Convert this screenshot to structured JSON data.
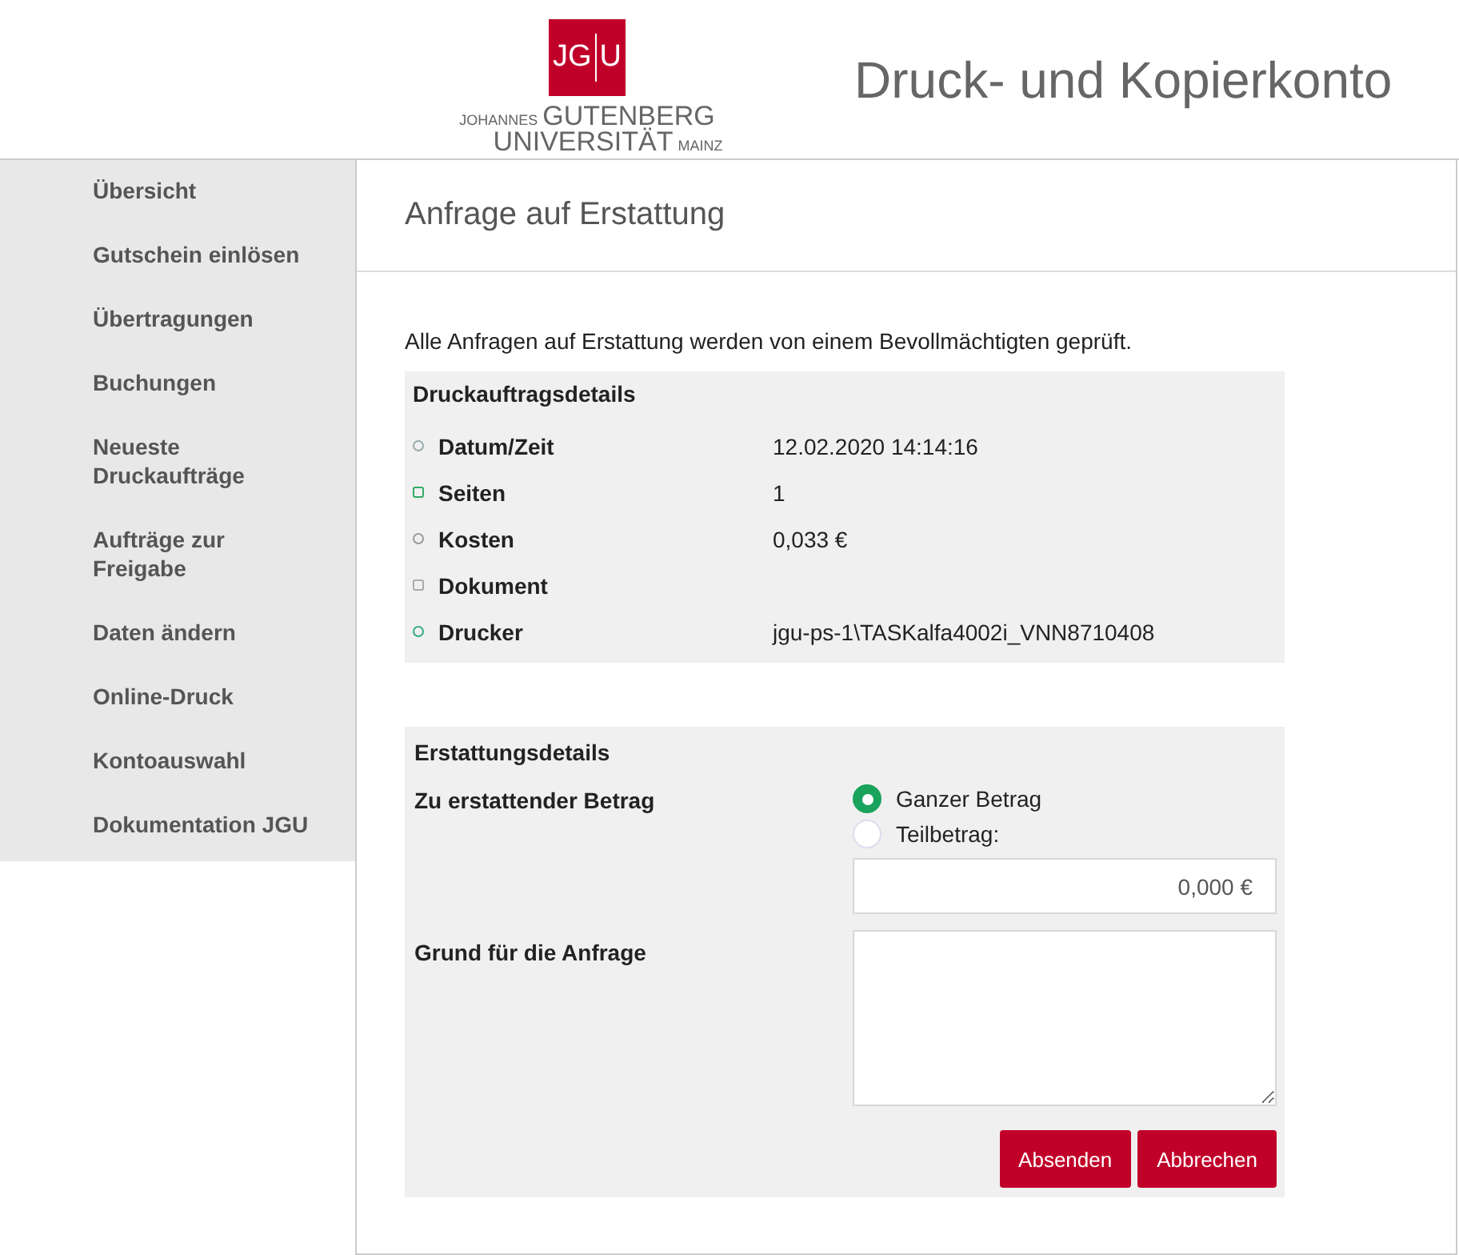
{
  "logo": {
    "mark_left": "JG",
    "mark_right": "U",
    "line1_small": "JOHANNES",
    "line1_big": "GUTENBERG",
    "line2_big": "UNIVERSITÄT",
    "line2_small": "MAINZ"
  },
  "header": {
    "title": "Druck- und Kopierkonto"
  },
  "sidebar": {
    "items": [
      {
        "label": "Übersicht"
      },
      {
        "label": "Gutschein einlösen"
      },
      {
        "label": "Übertragungen"
      },
      {
        "label": "Buchungen"
      },
      {
        "label": "Neueste Druckaufträge"
      },
      {
        "label": "Aufträge zur Freigabe"
      },
      {
        "label": "Daten ändern"
      },
      {
        "label": "Online-Druck"
      },
      {
        "label": "Kontoauswahl"
      },
      {
        "label": "Dokumentation JGU"
      }
    ]
  },
  "page": {
    "title": "Anfrage auf Erstattung",
    "intro": "Alle Anfragen auf Erstattung werden von einem Bevollmächtigten geprüft."
  },
  "job_details": {
    "heading": "Druckauftragsdetails",
    "rows": [
      {
        "label": "Datum/Zeit",
        "value": "12.02.2020 14:14:16"
      },
      {
        "label": "Seiten",
        "value": "1"
      },
      {
        "label": "Kosten",
        "value": "0,033 €"
      },
      {
        "label": "Dokument"
      },
      {
        "label": "Drucker",
        "value": "jgu-ps-1\\TASKalfa4002i_VNN8710408"
      }
    ]
  },
  "refund": {
    "heading": "Erstattungsdetails",
    "amount_label": "Zu erstattender Betrag",
    "options": [
      {
        "label": "Ganzer Betrag",
        "selected": true
      },
      {
        "label": "Teilbetrag:",
        "selected": false
      }
    ],
    "amount_field": {
      "value": "0,000 €"
    },
    "reason_label": "Grund für die Anfrage",
    "buttons": [
      "Absenden",
      "Abbrechen"
    ]
  }
}
